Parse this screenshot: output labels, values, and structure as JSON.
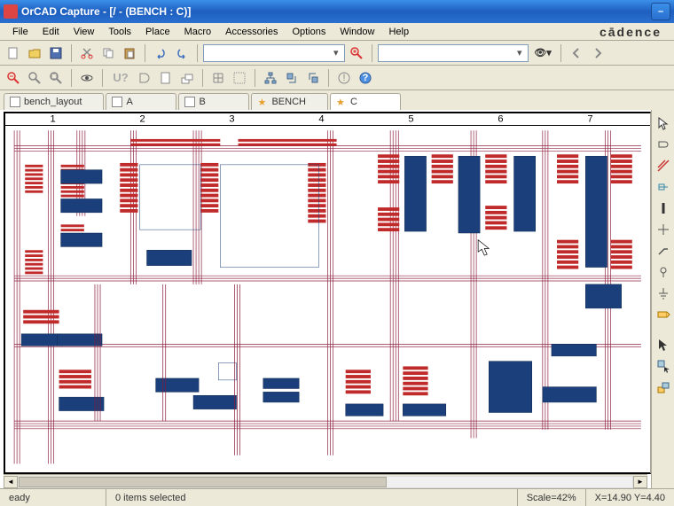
{
  "title": "OrCAD Capture - [/ - (BENCH : C)]",
  "brand": "cādence",
  "menu": [
    "File",
    "Edit",
    "View",
    "Tools",
    "Place",
    "Macro",
    "Accessories",
    "Options",
    "Window",
    "Help"
  ],
  "toolbar1": {
    "search_value": "",
    "refdes_value": "",
    "find": "",
    "binoc": "▾"
  },
  "tabs": [
    {
      "label": "bench_layout",
      "icon": "page",
      "active": false
    },
    {
      "label": "A",
      "icon": "page",
      "active": false
    },
    {
      "label": "B",
      "icon": "page",
      "active": false
    },
    {
      "label": "BENCH",
      "icon": "star",
      "active": false
    },
    {
      "label": "C",
      "icon": "star",
      "active": true
    }
  ],
  "u7_label": "U?",
  "ruler": [
    "1",
    "2",
    "3",
    "4",
    "5",
    "6",
    "7"
  ],
  "status": {
    "ready": "eady",
    "selection": "0 items selected",
    "scale": "Scale=42%",
    "coords": "X=14.90  Y=4.40"
  },
  "icons": {
    "minimize": "–",
    "dropdown": "▾",
    "left": "◄",
    "right": "►"
  },
  "colors": {
    "wire": "#8a1a3a",
    "comp_fill": "#c12a2a",
    "comp_body": "#1a3f7a",
    "xp_blue": "#2a70d0"
  }
}
